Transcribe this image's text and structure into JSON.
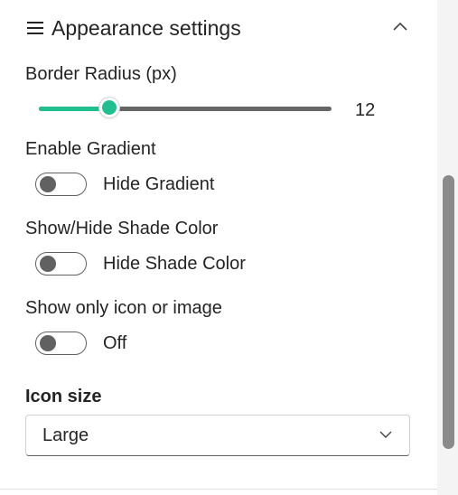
{
  "section": {
    "title": "Appearance settings",
    "menu_icon": "hamburger-icon",
    "collapse_icon": "chevron-up-icon"
  },
  "border_radius": {
    "label": "Border Radius (px)",
    "value": "12",
    "fill_fraction": 0.24
  },
  "gradient": {
    "label": "Enable Gradient",
    "toggle_text": "Hide Gradient",
    "on": false
  },
  "shade_color": {
    "label": "Show/Hide Shade Color",
    "toggle_text": "Hide Shade Color",
    "on": false
  },
  "icon_only": {
    "label": "Show only icon or image",
    "toggle_text": "Off",
    "on": false
  },
  "icon_size": {
    "label": "Icon size",
    "selected": "Large",
    "dropdown_icon": "chevron-down-icon"
  },
  "colors": {
    "accent": "#1fbf8f",
    "toggle_off": "#616161",
    "text": "#242424"
  }
}
